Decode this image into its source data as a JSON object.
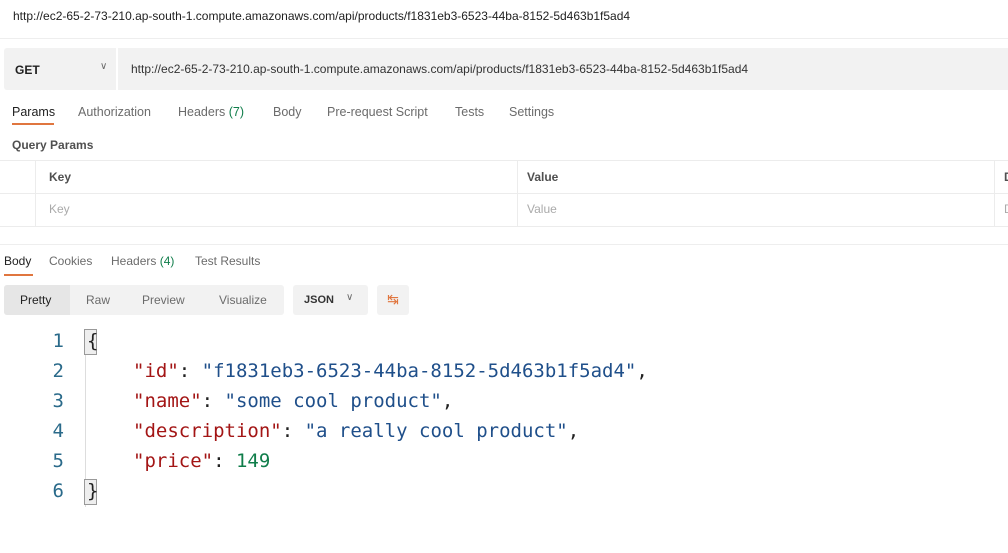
{
  "title": "http://ec2-65-2-73-210.ap-south-1.compute.amazonaws.com/api/products/f1831eb3-6523-44ba-8152-5d463b1f5ad4",
  "request": {
    "method": "GET",
    "url": "http://ec2-65-2-73-210.ap-south-1.compute.amazonaws.com/api/products/f1831eb3-6523-44ba-8152-5d463b1f5ad4"
  },
  "request_tabs": {
    "params": "Params",
    "authorization": "Authorization",
    "headers": "Headers",
    "headers_count": "(7)",
    "body": "Body",
    "prerequest": "Pre-request Script",
    "tests": "Tests",
    "settings": "Settings"
  },
  "query_params": {
    "title": "Query Params",
    "col_key": "Key",
    "col_value": "Value",
    "col_desc": "D",
    "ph_key": "Key",
    "ph_value": "Value",
    "ph_desc": "D"
  },
  "response_tabs": {
    "body": "Body",
    "cookies": "Cookies",
    "headers": "Headers",
    "headers_count": "(4)",
    "test_results": "Test Results"
  },
  "view": {
    "pretty": "Pretty",
    "raw": "Raw",
    "preview": "Preview",
    "visualize": "Visualize",
    "format": "JSON"
  },
  "code": {
    "line_numbers": [
      "1",
      "2",
      "3",
      "4",
      "5",
      "6"
    ],
    "open": "{",
    "close": "}",
    "id_key": "\"id\"",
    "id_val": "\"f1831eb3-6523-44ba-8152-5d463b1f5ad4\"",
    "name_key": "\"name\"",
    "name_val": "\"some cool product\"",
    "desc_key": "\"description\"",
    "desc_val": "\"a really cool product\"",
    "price_key": "\"price\"",
    "price_val": "149"
  },
  "colors": {
    "accent": "#e0763f",
    "count": "#0f7d4a",
    "key": "#a31515",
    "string": "#1f4f8a",
    "number": "#0f7d4a"
  }
}
